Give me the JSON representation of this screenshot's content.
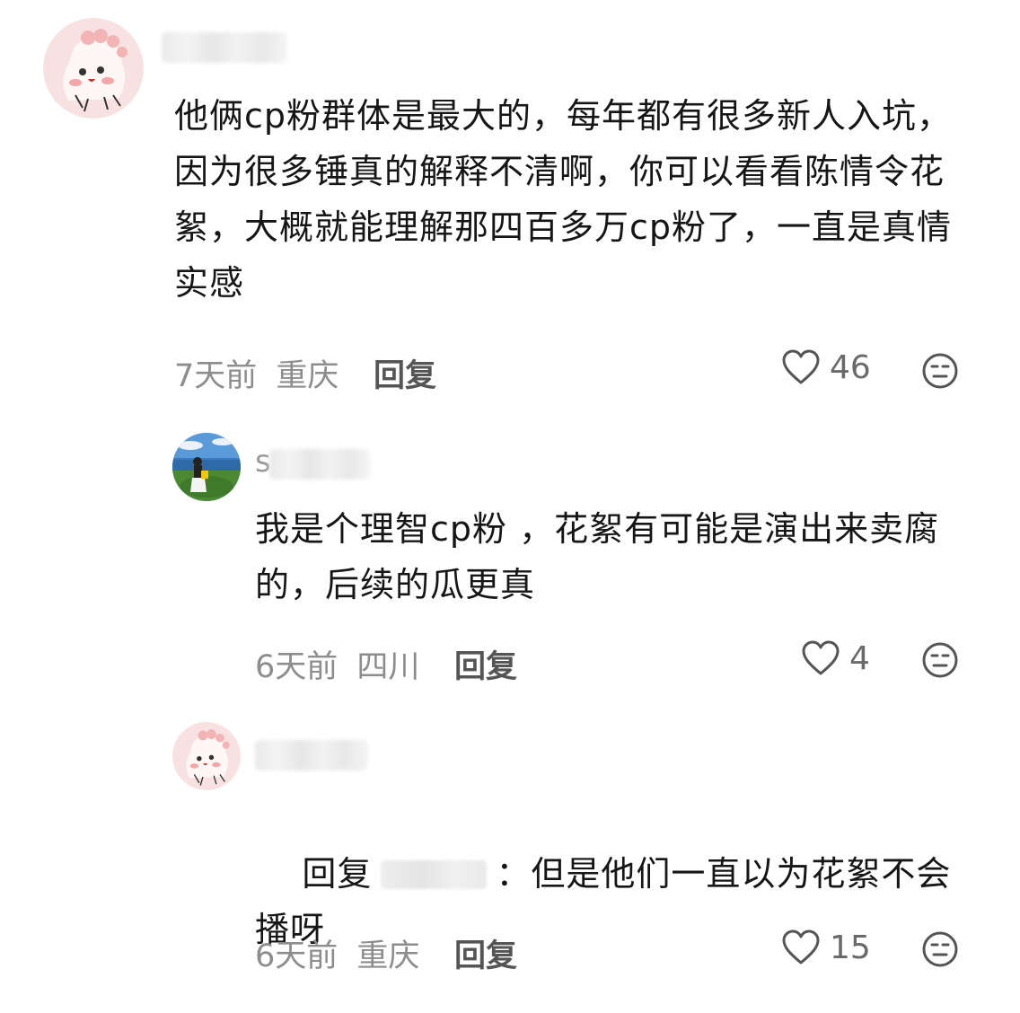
{
  "comments": [
    {
      "text": "他俩cp粉群体是最大的，每年都有很多新人入坑，因为很多锤真的解释不清啊，你可以看看陈情令花絮，大概就能理解那四百多万cp粉了，一直是真情实感",
      "time": "7天前",
      "location": "重庆",
      "reply_label": "回复",
      "likes": "46",
      "avatar": "pink-cartoon-avatar"
    },
    {
      "username_first_char": "s",
      "text": "我是个理智cp粉 ，花絮有可能是演出来卖腐的，后续的瓜更真",
      "time": "6天前",
      "location": "四川",
      "reply_label": "回复",
      "likes": "4",
      "avatar": "photo-avatar-grass-sky"
    },
    {
      "reply_prefix": "回复",
      "text": "：但是他们一直以为花絮不会播呀",
      "time": "6天前",
      "location": "重庆",
      "reply_label": "回复",
      "likes": "15",
      "avatar": "pink-cartoon-avatar"
    }
  ],
  "icons": {
    "like": "heart-outline-icon",
    "dislike": "neutral-face-icon"
  },
  "colors": {
    "text": "#161616",
    "meta": "#8d8d8d",
    "avatar_pink": "#f7dede"
  }
}
